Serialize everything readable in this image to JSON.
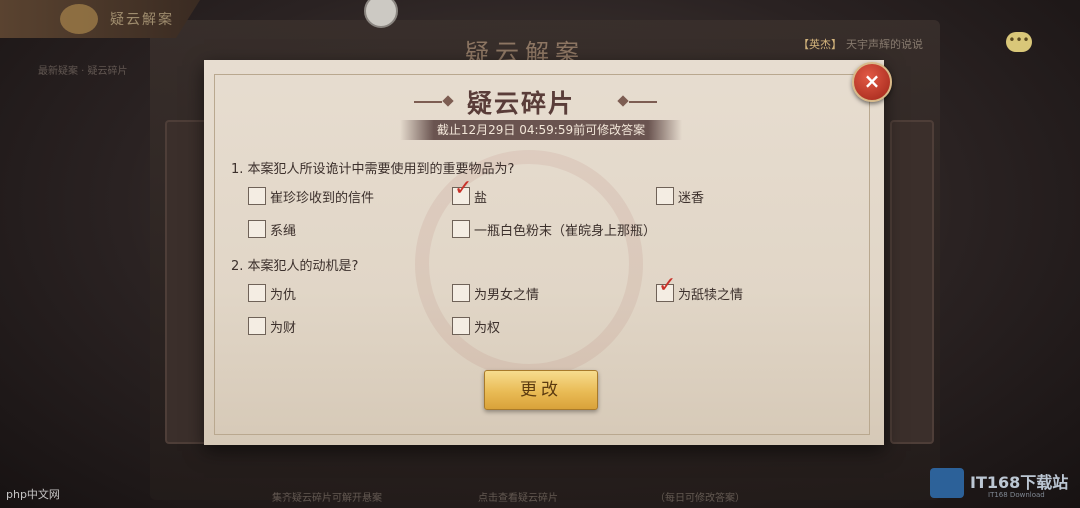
{
  "background": {
    "mode_tab_title": "疑云解案",
    "board_title": "疑云解案",
    "subtitle_faded": "最新疑案 · 疑云碎片",
    "chat": {
      "tag": "【英杰】",
      "text": "天宇声辉的说说"
    },
    "bottom_hints": [
      "集齐疑云碎片可解开悬案",
      "点击查看疑云碎片",
      "（每日可修改答案）"
    ]
  },
  "dialog": {
    "title": "疑云碎片",
    "deadline": "截止12月29日 04:59:59前可修改答案",
    "close_symbol": "×",
    "questions": [
      {
        "text": "1. 本案犯人所设诡计中需要使用到的重要物品为?",
        "options": [
          {
            "label": "崔珍珍收到的信件",
            "checked": false
          },
          {
            "label": "盐",
            "checked": true
          },
          {
            "label": "迷香",
            "checked": false
          },
          {
            "label": "系绳",
            "checked": false
          },
          {
            "label": "一瓶白色粉末（崔皖身上那瓶）",
            "checked": false
          }
        ]
      },
      {
        "text": "2. 本案犯人的动机是?",
        "options": [
          {
            "label": "为仇",
            "checked": false
          },
          {
            "label": "为男女之情",
            "checked": false
          },
          {
            "label": "为舐犊之情",
            "checked": true
          },
          {
            "label": "为财",
            "checked": false
          },
          {
            "label": "为权",
            "checked": false
          }
        ]
      }
    ],
    "submit_label": "更改"
  },
  "check_mark": "✓",
  "watermarks": {
    "left": "php中文网",
    "right": "IT168下载站",
    "right_sub": "IT168 Download"
  }
}
